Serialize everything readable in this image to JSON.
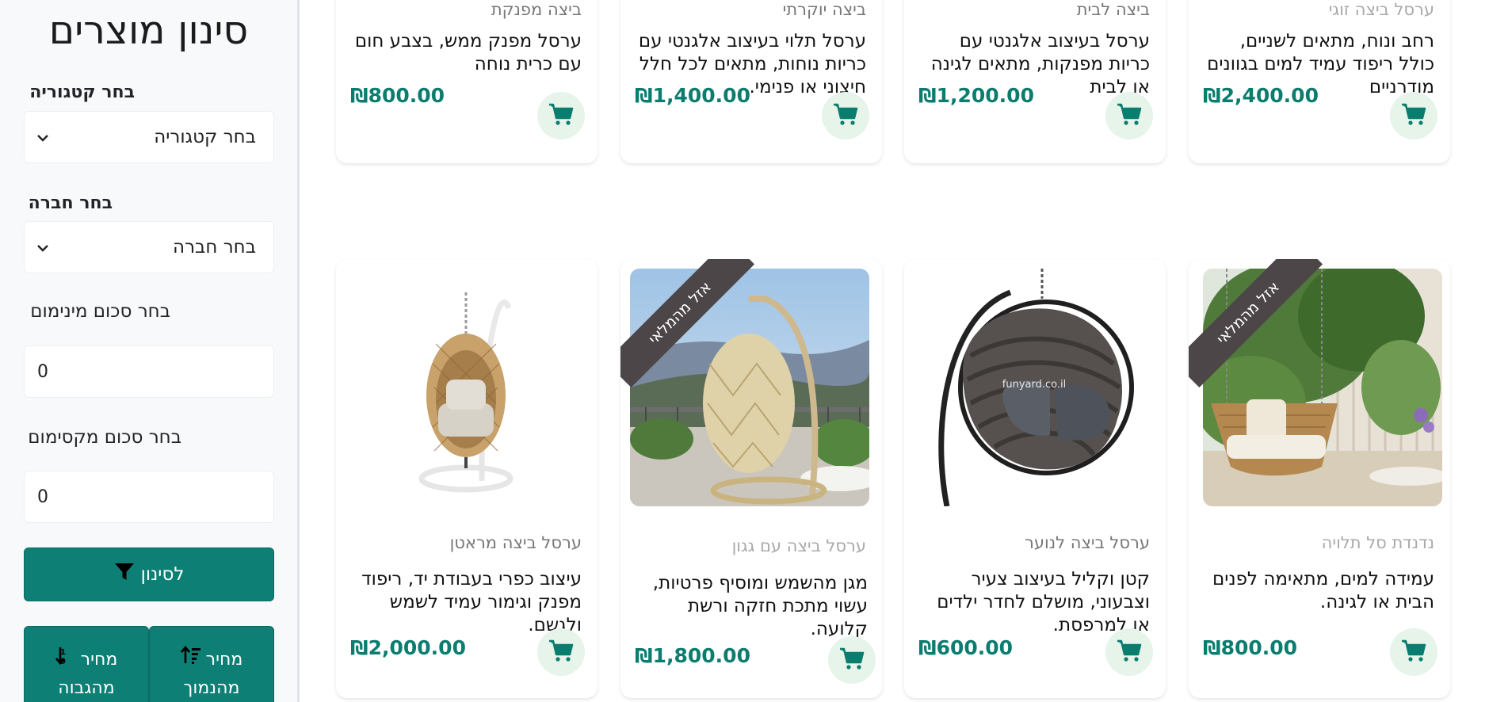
{
  "sidebar": {
    "title": "סינון מוצרים",
    "category_label": "בחר קטגוריה",
    "category_value": "בחר קטגוריה",
    "company_label": "בחר חברה",
    "company_value": "בחר חברה",
    "min_label": "בחר סכום מינימום",
    "min_value": "0",
    "max_label": "בחר סכום מקסימום",
    "max_value": "0",
    "filter_button": "לסינון",
    "sort_asc_line1": "מחיר",
    "sort_asc_line2": "מהנמוך",
    "sort_desc_line1": "מחיר",
    "sort_desc_line2": "מהגבוה"
  },
  "top_row": [
    {
      "subtitle": "ביצה מפנקת",
      "description": "ערסל מפנק ממש, בצבע חום עם כרית נוחה",
      "price": "₪800.00"
    },
    {
      "subtitle": "ביצה יוקרתי",
      "description": "ערסל תלוי בעיצוב אלגנטי עם כריות נוחות, מתאים לכל חלל חיצוני או פנימי.",
      "price": "₪1,400.00"
    },
    {
      "subtitle": "ביצה לבית",
      "description": "ערסל בעיצוב אלגנטי עם כריות מפנקות, מתאים לגינה או לבית",
      "price": "₪1,200.00"
    },
    {
      "subtitle": "ערסל ביצה זוגי",
      "description": "רחב ונוח, מתאים לשניים, כולל ריפוד עמיד למים בגוונים מודרניים",
      "price": "₪2,400.00"
    }
  ],
  "bottom_row": [
    {
      "subtitle": "ערסל ביצה מראטן",
      "description": "עיצוב כפרי בעבודת יד, ריפוד מפנק וגימור עמיד לשמש ולגשם.",
      "price": "₪2,000.00",
      "ribbon": ""
    },
    {
      "subtitle": "ערסל ביצה עם גגון",
      "description": "מגן מהשמש ומוסיף פרטיות, עשוי מתכת חזקה ורשת קלועה.",
      "price": "₪1,800.00",
      "ribbon": "אזל מהמלאי"
    },
    {
      "subtitle": "ערסל ביצה לנוער",
      "description": "קטן וקליל בעיצוב צעיר וצבעוני, מושלם לחדר ילדים או למרפסת.",
      "price": "₪600.00",
      "ribbon": "",
      "watermark": "funyard.co.il"
    },
    {
      "subtitle": "נדנדת סל תלויה",
      "description": "עמידה למים, מתאימה לפנים הבית או לגינה.",
      "price": "₪800.00",
      "ribbon": "אזל מהמלאי"
    }
  ],
  "colors": {
    "accent": "#0d7f74",
    "price": "#0b7d6f",
    "cart_bg": "#e6f4ea",
    "ribbon": "#4c4648"
  },
  "icons": [
    "chevron-down-icon",
    "filter-icon",
    "sort-ascending-icon",
    "sort-descending-icon",
    "cart-icon"
  ]
}
